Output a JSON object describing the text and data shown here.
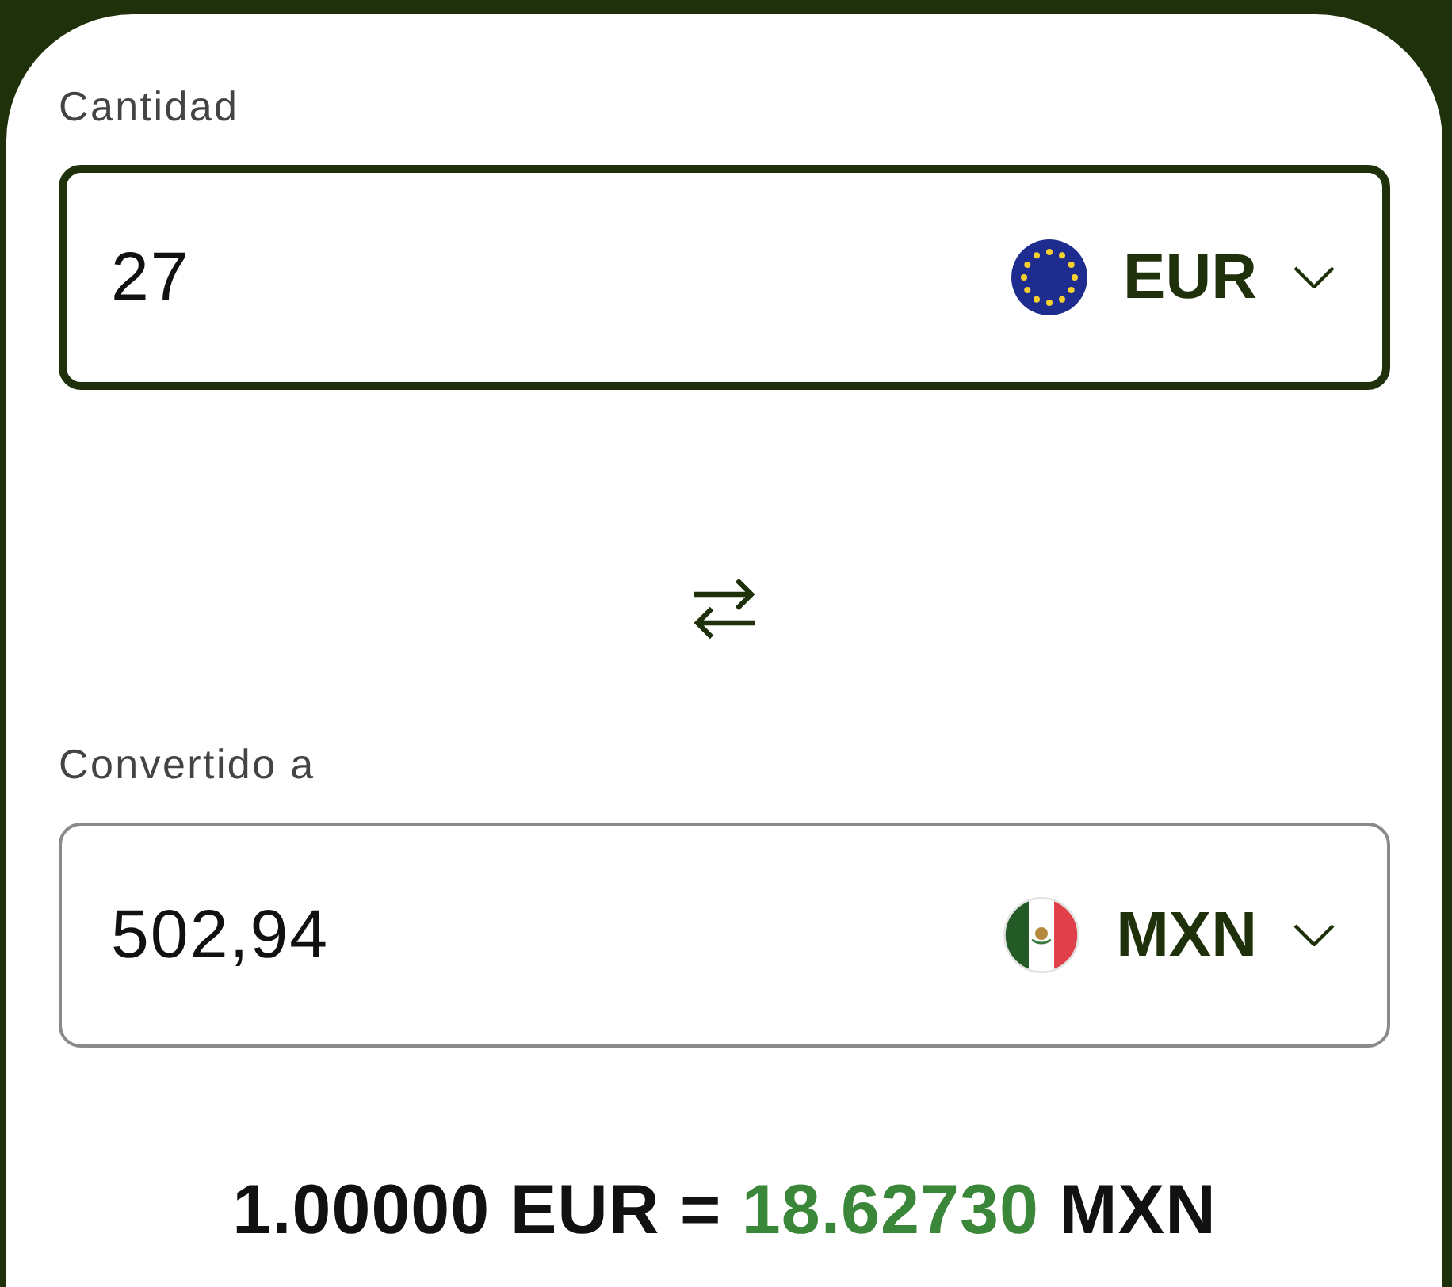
{
  "amount": {
    "label": "Cantidad",
    "value": "27",
    "currency": "EUR",
    "kind": "eu",
    "focused": true
  },
  "converted": {
    "label": "Convertido a",
    "value": "502,94",
    "currency": "MXN",
    "kind": "mx",
    "focused": false
  },
  "rate": {
    "base": "1.00000 EUR =",
    "value": "18.62730",
    "quote": "MXN"
  }
}
